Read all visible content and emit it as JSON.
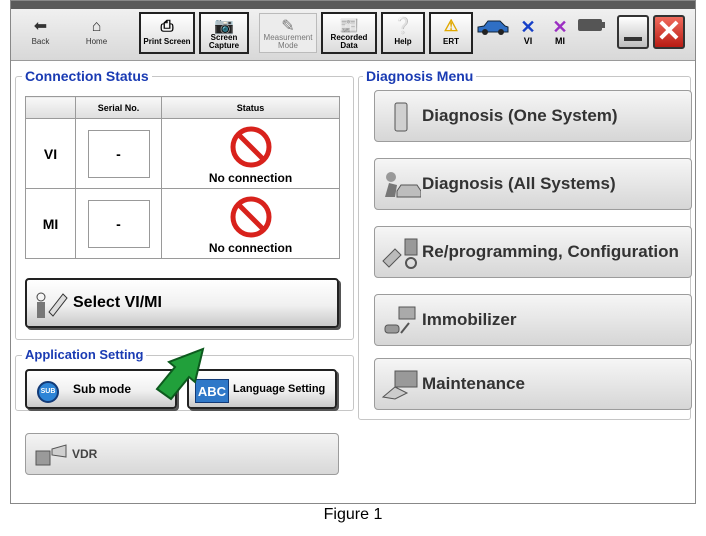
{
  "toolbar": {
    "back": "Back",
    "home": "Home",
    "print_screen": "Print Screen",
    "screen_capture_1": "Screen",
    "screen_capture_2": "Capture",
    "measurement_1": "Measurement",
    "measurement_2": "Mode",
    "recorded_1": "Recorded",
    "recorded_2": "Data",
    "help": "Help",
    "ert": "ERT",
    "vi": "VI",
    "mi": "MI"
  },
  "connection_status": {
    "legend": "Connection Status",
    "columns": [
      "Serial No.",
      "Status"
    ],
    "rows": [
      {
        "label": "VI",
        "serial": "-",
        "status": "No connection"
      },
      {
        "label": "MI",
        "serial": "-",
        "status": "No connection"
      }
    ],
    "select_button": "Select VI/MI"
  },
  "application_setting": {
    "legend": "Application Setting",
    "sub_mode": "Sub mode",
    "sub_icon": "SUB",
    "language": "Language Setting",
    "language_icon": "ABC"
  },
  "vdr": "VDR",
  "diagnosis_menu": {
    "legend": "Diagnosis Menu",
    "items": [
      {
        "label": "Diagnosis (One System)",
        "icon": "device-icon"
      },
      {
        "label": "Diagnosis (All Systems)",
        "icon": "mechanic-car-icon"
      },
      {
        "label": "Re/programming, Configuration",
        "icon": "reprogramming-icon"
      },
      {
        "label": "Immobilizer",
        "icon": "key-icon"
      },
      {
        "label": "Maintenance",
        "icon": "maintenance-icon"
      }
    ]
  },
  "caption": "Figure 1",
  "colors": {
    "legend_blue": "#1a3bb3",
    "no_connection_red": "#d8221c",
    "arrow_green": "#21a03b",
    "close_red": "#d9302a"
  }
}
